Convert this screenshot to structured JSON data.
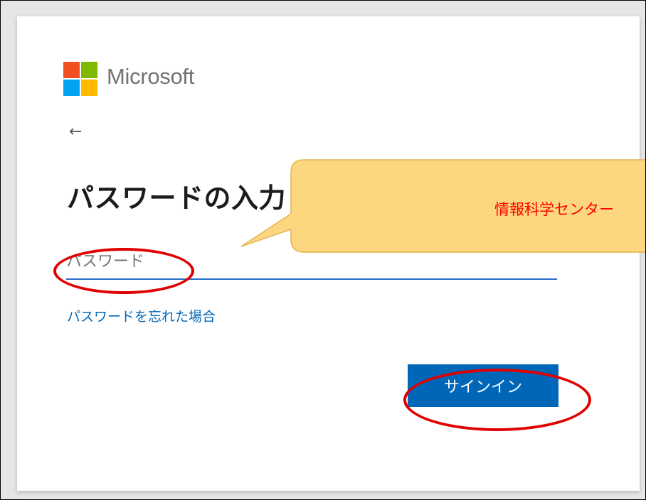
{
  "brand": {
    "name": "Microsoft",
    "logo_colors": [
      "#f25022",
      "#7fba00",
      "#00a4ef",
      "#ffb900"
    ]
  },
  "nav": {
    "back_icon": "arrow-left-icon",
    "back_glyph": "←"
  },
  "page": {
    "title": "パスワードの入力"
  },
  "password_field": {
    "placeholder": "パスワード",
    "value": ""
  },
  "links": {
    "forgot_password": "パスワードを忘れた場合"
  },
  "actions": {
    "signin_label": "サインイン"
  },
  "annotation": {
    "callout_text": "情報科学センター"
  },
  "colors": {
    "primary": "#0067b8",
    "input_underline": "#2a6fc9",
    "callout_fill": "#fdd77f",
    "callout_text": "#ff0000",
    "highlight_ring": "#e00000"
  }
}
